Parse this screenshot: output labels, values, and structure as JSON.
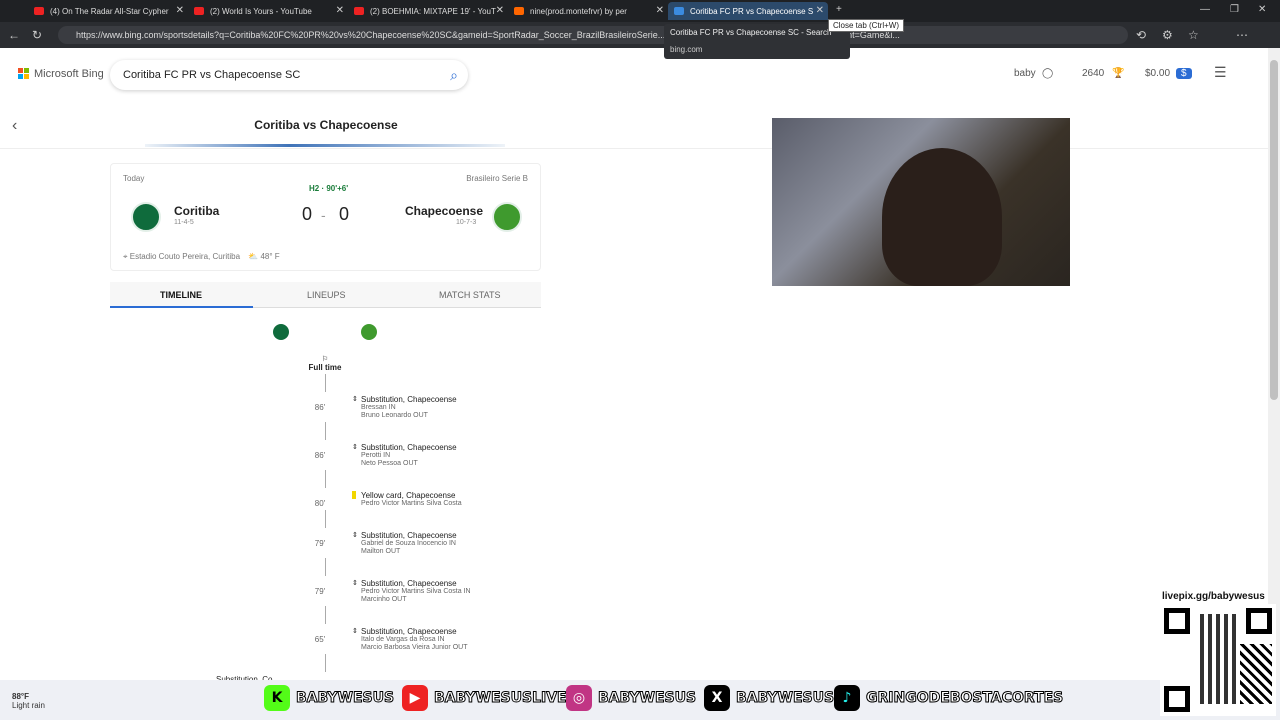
{
  "browser": {
    "tabs": [
      {
        "label": "(4) On The Radar All-Star Cypher",
        "icon": "youtube-icon"
      },
      {
        "label": "(2) World Is Yours - YouTube",
        "icon": "youtube-icon"
      },
      {
        "label": "(2) BOEHMIA: MIXTAPE 19' - YouT",
        "icon": "youtube-icon"
      },
      {
        "label": "nine(prod.montefrvr) by per",
        "icon": "soundcloud-icon"
      },
      {
        "label": "Coritiba FC PR vs Chapecoense S",
        "icon": "bing-icon"
      }
    ],
    "url": "https://www.bing.com/sportsdetails?q=Coritiba%20FC%20PR%20vs%20Chapecoense%20SC&gameid=SportRadar_Soccer_BrazilBrasileiroSerie...BrasileiroSerieB&scenario=GameCenter&intent=Game&i...",
    "tooltip_title": "Coritiba FC PR vs Chapecoense SC - Search",
    "tooltip_domain": "bing.com",
    "close_tab_tip": "Close tab (Ctrl+W)"
  },
  "header": {
    "logo_text": "Microsoft Bing",
    "search_query": "Coritiba FC PR vs Chapecoense SC",
    "user_name": "baby",
    "points": "2640",
    "balance": "$0.00"
  },
  "match": {
    "page_title": "Coritiba vs Chapecoense",
    "day": "Today",
    "league": "Brasileiro Serie B",
    "period": "H2 · 90'+6'",
    "home": {
      "name": "Coritiba",
      "record": "11-4-5",
      "score": "0"
    },
    "away": {
      "name": "Chapecoense",
      "record": "10-7-3",
      "score": "0"
    },
    "separator": "-",
    "venue": "Estadio Couto Pereira, Curitiba",
    "weather": "48° F"
  },
  "tabs": {
    "timeline": "TIMELINE",
    "lineups": "LINEUPS",
    "stats": "MATCH STATS"
  },
  "timeline": {
    "full_time": "Full time",
    "events": [
      {
        "minute": "86'",
        "type": "Substitution, Chapecoense",
        "line1": "Bressan IN",
        "line2": "Bruno Leonardo OUT",
        "kind": "sub"
      },
      {
        "minute": "86'",
        "type": "Substitution, Chapecoense",
        "line1": "Perotti IN",
        "line2": "Neto Pessoa OUT",
        "kind": "sub"
      },
      {
        "minute": "80'",
        "type": "Yellow card, Chapecoense",
        "line1": "Pedro Victor Martins Silva Costa",
        "line2": "",
        "kind": "yellow"
      },
      {
        "minute": "79'",
        "type": "Substitution, Chapecoense",
        "line1": "Gabriel de Souza Inocencio IN",
        "line2": "Mailton OUT",
        "kind": "sub"
      },
      {
        "minute": "79'",
        "type": "Substitution, Chapecoense",
        "line1": "Pedro Victor Martins Silva Costa IN",
        "line2": "Marcinho OUT",
        "kind": "sub"
      },
      {
        "minute": "65'",
        "type": "Substitution, Chapecoense",
        "line1": "Italo de Vargas da Rosa IN",
        "line2": "Marcio Barbosa Vieira Junior OUT",
        "kind": "sub"
      }
    ],
    "partial": "Substitution, Co..."
  },
  "overlay": {
    "kick": "BABYWESUS",
    "youtube": "BABYWESUSLIVE",
    "instagram": "BABYWESUS",
    "x": "BABYWESUS",
    "tiktok": "GRINGODEBOSTACORTES",
    "qr_label": "livepix.gg/babywesus"
  },
  "taskbar": {
    "temp": "88°F",
    "condition": "Light rain"
  },
  "colors": {
    "accent": "#2b6cd4",
    "youtube": "#e22",
    "kick": "#53fc18",
    "coritiba": "#0f6b3c",
    "chapecoense": "#3f9a2e"
  }
}
